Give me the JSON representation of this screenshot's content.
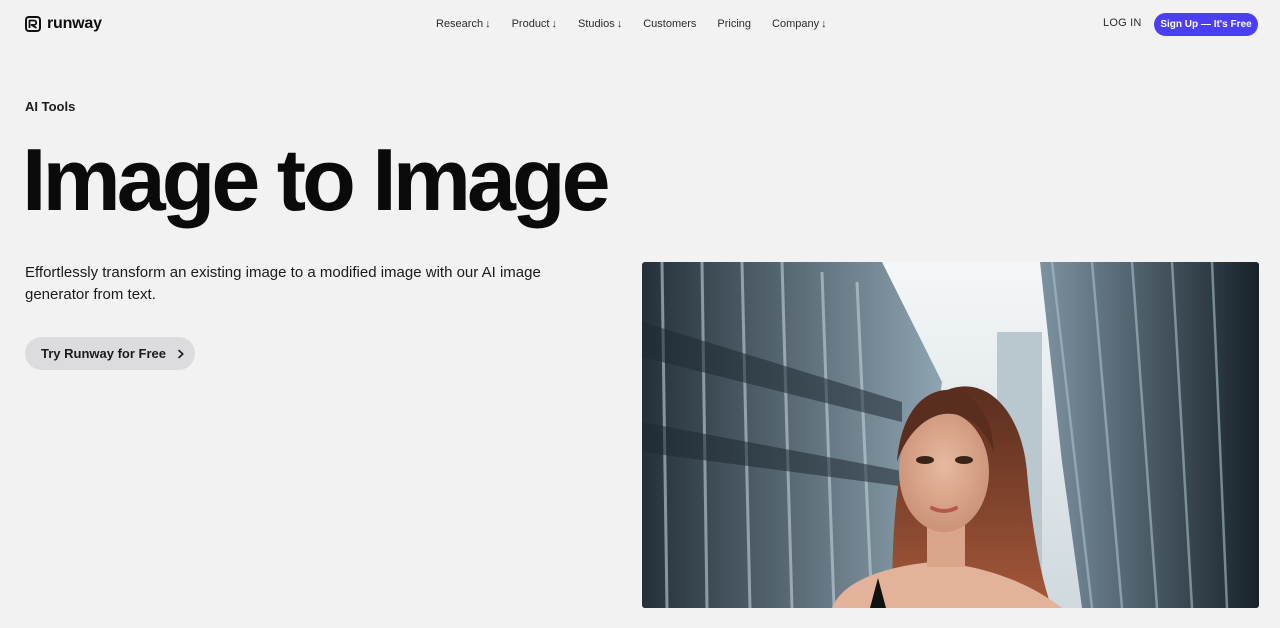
{
  "brand": {
    "name": "runway"
  },
  "nav": {
    "links": [
      {
        "label": "Research",
        "arrow": "↓"
      },
      {
        "label": "Product",
        "arrow": "↓"
      },
      {
        "label": "Studios",
        "arrow": "↓"
      },
      {
        "label": "Customers",
        "arrow": ""
      },
      {
        "label": "Pricing",
        "arrow": ""
      },
      {
        "label": "Company",
        "arrow": "↓"
      }
    ],
    "login": "LOG IN",
    "signup": "Sign Up — It's Free"
  },
  "hero": {
    "eyebrow": "AI Tools",
    "title": "Image to Image",
    "description": "Effortlessly transform an existing image to a modified image with our AI image generator from text.",
    "cta": "Try Runway for Free"
  },
  "colors": {
    "accent": "#4a3ff5",
    "background": "#f2f2f2",
    "cta_bg": "#dcdcde"
  }
}
